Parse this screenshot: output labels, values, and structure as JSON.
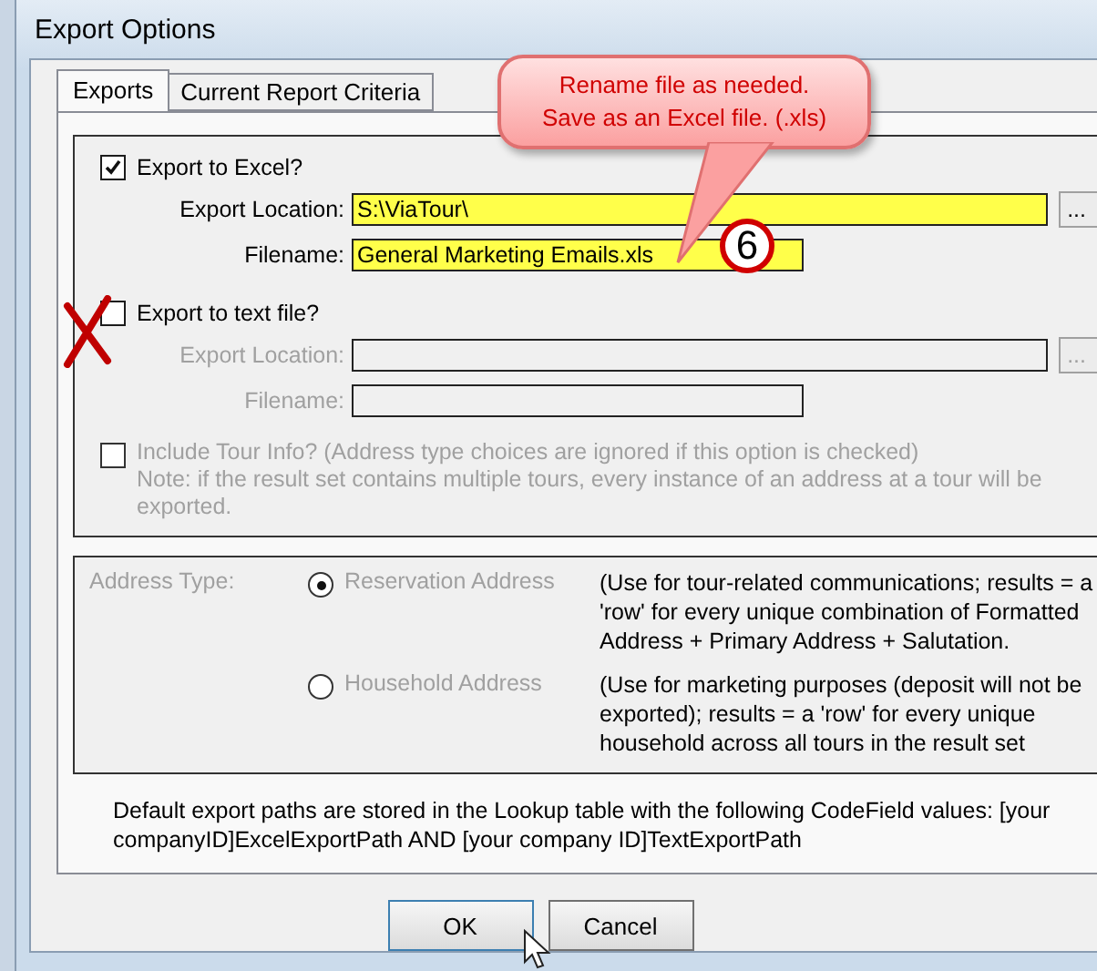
{
  "window": {
    "title": "Export Options"
  },
  "tabs": [
    {
      "label": "Exports",
      "selected": true
    },
    {
      "label": "Current Report Criteria",
      "selected": false
    }
  ],
  "excel": {
    "label": "Export to Excel?",
    "checked": true,
    "location_label": "Export Location:",
    "location": "S:\\ViaTour\\",
    "filename_label": "Filename:",
    "filename": "General Marketing Emails.xls",
    "browse": "...",
    "highlighted": true
  },
  "text_file": {
    "label": "Export to text file?",
    "checked": false,
    "location_label": "Export Location:",
    "filename_label": "Filename:",
    "browse": "...",
    "fields_disabled": true,
    "highlighted": false
  },
  "include_tour": {
    "label": "Include Tour Info? (Address type choices are ignored if this option is checked)",
    "note": "Note: if the result set contains multiple tours, every instance of an address at a tour will be exported.",
    "checked": false,
    "disabled": true
  },
  "address_type": {
    "label": "Address Type:",
    "disabled": true,
    "options": [
      {
        "label": "Reservation Address",
        "selected": true,
        "description": "(Use for tour-related communications; results = a 'row' for every unique combination of Formatted Address + Primary Address + Salutation."
      },
      {
        "label": "Household Address",
        "selected": false,
        "description": "(Use for marketing purposes (deposit will not be exported); results = a 'row' for every unique household across all tours in the result set"
      }
    ]
  },
  "footer_note": "Default export paths are stored in the Lookup table with the following CodeField values: [your companyID]ExcelExportPath AND [your company ID]TextExportPath",
  "buttons": [
    {
      "label": "OK",
      "kind": "default"
    },
    {
      "label": "Cancel",
      "kind": "normal"
    }
  ],
  "annotation": {
    "callout": "Rename file as needed.\nSave as an Excel file. (.xls)",
    "step": "6"
  }
}
